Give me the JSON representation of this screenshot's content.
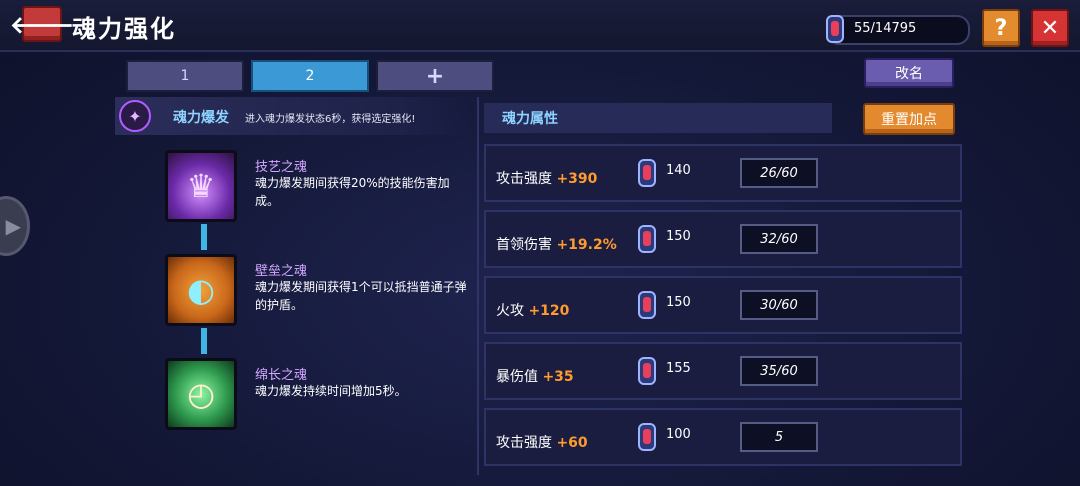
{
  "header": {
    "title": "魂力强化",
    "currency": "55/14795",
    "help_label": "?",
    "close_label": "✕",
    "back_label": "🡐"
  },
  "tabs": [
    {
      "label": "1"
    },
    {
      "label": "2"
    },
    {
      "label": "+"
    }
  ],
  "rename_label": "改名",
  "burst": {
    "name": "魂力爆发",
    "description": "进入魂力爆发状态6秒，获得选定强化!"
  },
  "souls": [
    {
      "name": "技艺之魂",
      "description": "魂力爆发期间获得20%的技能伤害加成。",
      "icon": "purple-flame-icon"
    },
    {
      "name": "壁垒之魂",
      "description": "魂力爆发期间获得1个可以抵挡普通子弹的护盾。",
      "icon": "shield-icon"
    },
    {
      "name": "绵长之魂",
      "description": "魂力爆发持续时间增加5秒。",
      "icon": "stopwatch-icon"
    }
  ],
  "attributes_title": "魂力属性",
  "reset_label": "重置加点",
  "attributes": [
    {
      "label": "攻击强度",
      "bonus": "+390",
      "cost": "140",
      "level": "26/60"
    },
    {
      "label": "首领伤害",
      "bonus": "+19.2%",
      "cost": "150",
      "level": "32/60"
    },
    {
      "label": "火攻",
      "bonus": "+120",
      "cost": "150",
      "level": "30/60"
    },
    {
      "label": "暴伤值",
      "bonus": "+35",
      "cost": "155",
      "level": "35/60"
    },
    {
      "label": "攻击强度",
      "bonus": "+60",
      "cost": "100",
      "level": "5"
    }
  ]
}
